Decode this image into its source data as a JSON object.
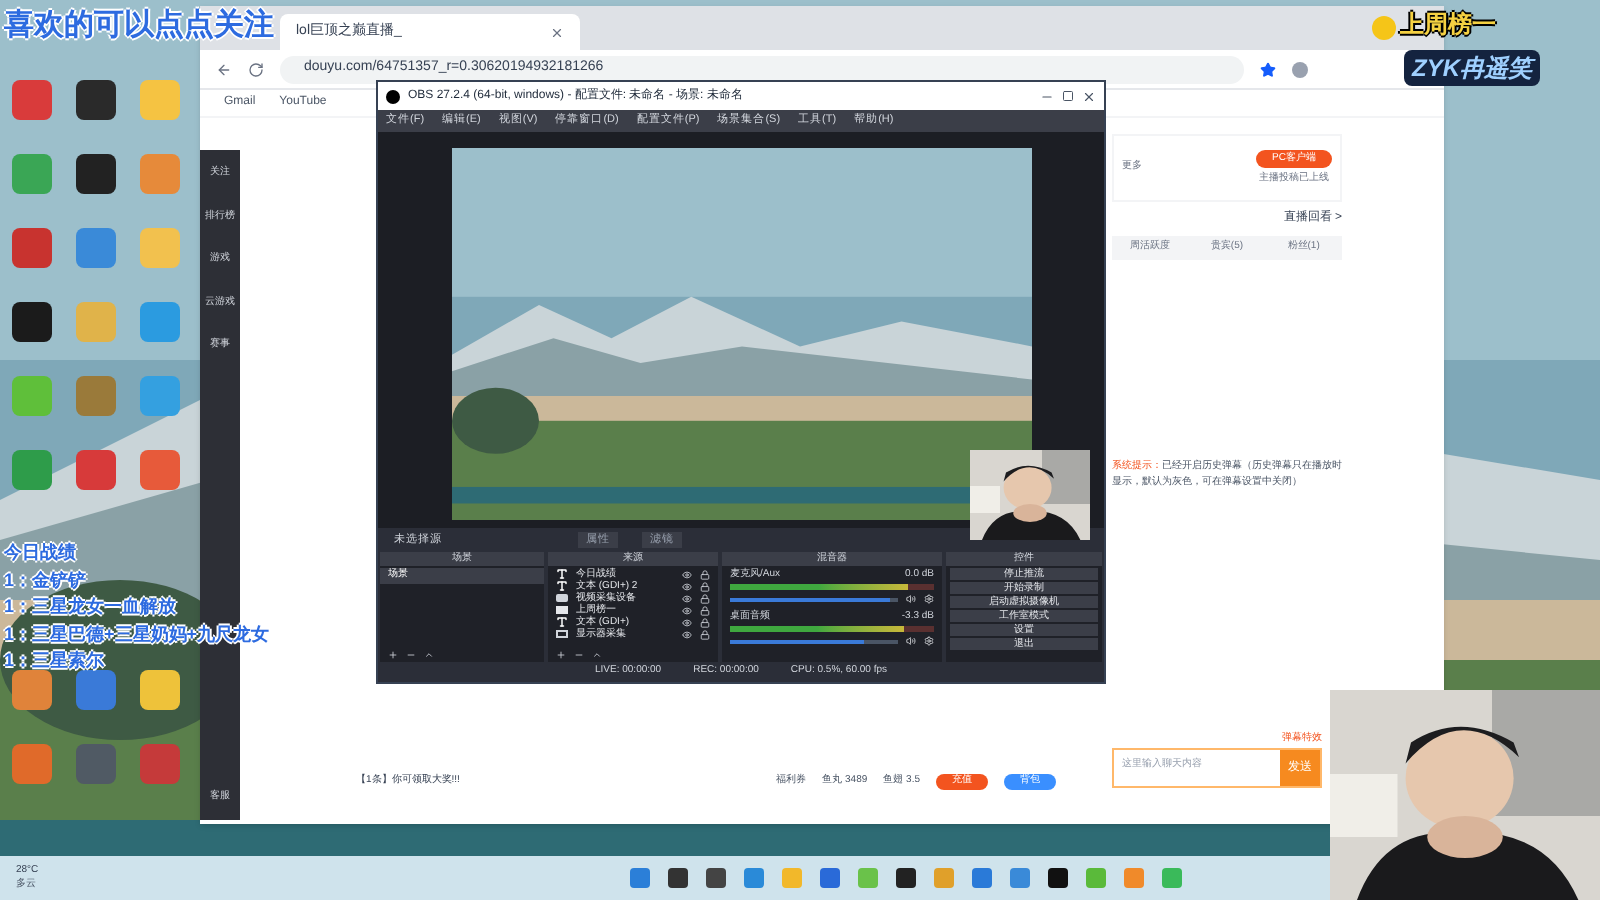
{
  "overlay": {
    "follow_text": "喜欢的可以点点关注",
    "record_title": "今日战绩",
    "records": [
      "1：金铲铲",
      "1：三星龙女一血解放",
      "1：三星巴德+三星奶妈+九尺龙女",
      "1：三星索尔"
    ],
    "top_fan_label": "上周榜一",
    "top_fan_name": "ZYK冉遥笑"
  },
  "browser": {
    "tab_title": "lol巨顶之巅直播_",
    "address": "douyu.com/64751357_r=0.30620194932181266",
    "bookmarks": [
      "Gmail",
      "YouTube"
    ],
    "sidebar": [
      "关注",
      "排行榜",
      "游戏",
      "云游戏",
      "赛事"
    ],
    "sidebar_bottom": "客服",
    "client_button": "PC客户端",
    "client_note": "主播投稿已上线",
    "more": "更多",
    "replay": "直播回看 >",
    "tabs": [
      {
        "label": "周活跃度",
        "selected": false
      },
      {
        "label": "贵宾(5)",
        "selected": false
      },
      {
        "label": "粉丝(1)",
        "selected": false
      }
    ],
    "system_label": "系统提示：",
    "system_text": "已经开启历史弹幕（历史弹幕只在播放时显示，默认为灰色，可在弹幕设置中关闭）",
    "effect": "弹幕特效",
    "chat_placeholder": "这里输入聊天内容",
    "send": "发送",
    "gift_notice": "【1条】你可领取大奖!!!",
    "welfare": "福利券",
    "fish_balls": "鱼丸 3489",
    "fish_fins": "鱼翅 3.5",
    "recharge": "充值",
    "backpack": "背包"
  },
  "obs": {
    "title": "OBS 27.2.4 (64-bit, windows) - 配置文件: 未命名 - 场景: 未命名",
    "menu": [
      "文件(F)",
      "编辑(E)",
      "视图(V)",
      "停靠窗口(D)",
      "配置文件(P)",
      "场景集合(S)",
      "工具(T)",
      "帮助(H)"
    ],
    "no_source": "未选择源",
    "properties": "属性",
    "filters": "滤镜",
    "docks": [
      "场景",
      "来源",
      "混音器",
      "控件"
    ],
    "scenes": [
      {
        "label": "场景",
        "selected": true
      }
    ],
    "sources": [
      {
        "label": "今日战绩",
        "kind": "text"
      },
      {
        "label": "文本 (GDI+) 2",
        "kind": "text"
      },
      {
        "label": "视频采集设备",
        "kind": "camera"
      },
      {
        "label": "上周榜一",
        "kind": "folder"
      },
      {
        "label": "文本 (GDI+)",
        "kind": "text"
      },
      {
        "label": "显示器采集",
        "kind": "monitor"
      }
    ],
    "channels": [
      {
        "name": "麦克风/Aux",
        "reading": "0.0 dB",
        "meter": {
          "level": 0.87
        },
        "volume": {
          "level": 0.95
        }
      },
      {
        "name": "桌面音频",
        "reading": "-3.3 dB",
        "meter": {
          "level": 0.85
        },
        "volume": {
          "level": 0.8
        }
      }
    ],
    "controls": [
      "停止推流",
      "开始录制",
      "启动虚拟摄像机",
      "工作室模式",
      "设置",
      "退出"
    ],
    "status": [
      "LIVE: 00:00:00",
      "REC: 00:00:00",
      "CPU: 0.5%, 60.00 fps"
    ]
  },
  "taskbar": {
    "temperature": "28°C",
    "weather": "多云"
  }
}
